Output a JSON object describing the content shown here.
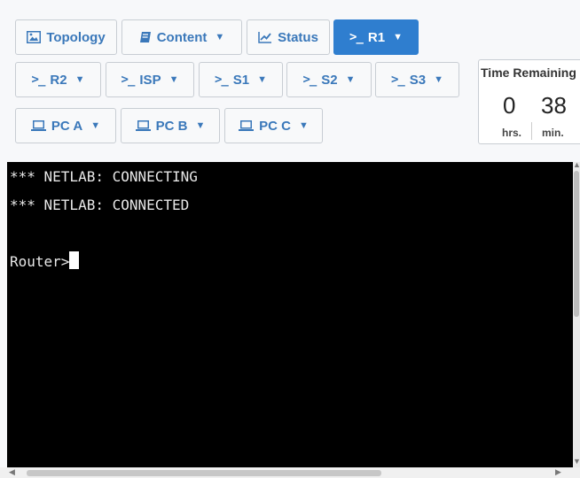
{
  "toolbar": {
    "row1": [
      {
        "label": "Topology",
        "icon": "image-icon",
        "dropdown": false
      },
      {
        "label": "Content",
        "icon": "book-icon",
        "dropdown": true
      },
      {
        "label": "Status",
        "icon": "line-chart-icon",
        "dropdown": false
      },
      {
        "label": "R1",
        "icon": "terminal-prompt-icon",
        "dropdown": true,
        "active": true
      }
    ],
    "row2": [
      {
        "label": "R2",
        "icon": "terminal-prompt-icon"
      },
      {
        "label": "ISP",
        "icon": "terminal-prompt-icon"
      },
      {
        "label": "S1",
        "icon": "terminal-prompt-icon"
      },
      {
        "label": "S2",
        "icon": "terminal-prompt-icon"
      },
      {
        "label": "S3",
        "icon": "terminal-prompt-icon"
      }
    ],
    "row3": [
      {
        "label": "PC A",
        "icon": "laptop-icon"
      },
      {
        "label": "PC B",
        "icon": "laptop-icon"
      },
      {
        "label": "PC C",
        "icon": "laptop-icon"
      }
    ],
    "prompt_glyph": ">_",
    "caret_glyph": "▼"
  },
  "timer": {
    "title": "Time Remaining",
    "hours": "0",
    "hours_unit": "hrs.",
    "minutes": "38",
    "minutes_unit": "min."
  },
  "terminal": {
    "lines": [
      "*** NETLAB: CONNECTING",
      "*** NETLAB: CONNECTED",
      "",
      "Router>"
    ]
  },
  "colors": {
    "accent": "#2f7ecf",
    "button_text": "#3a78ba",
    "terminal_bg": "#000000",
    "terminal_fg": "#e8e8e8"
  }
}
